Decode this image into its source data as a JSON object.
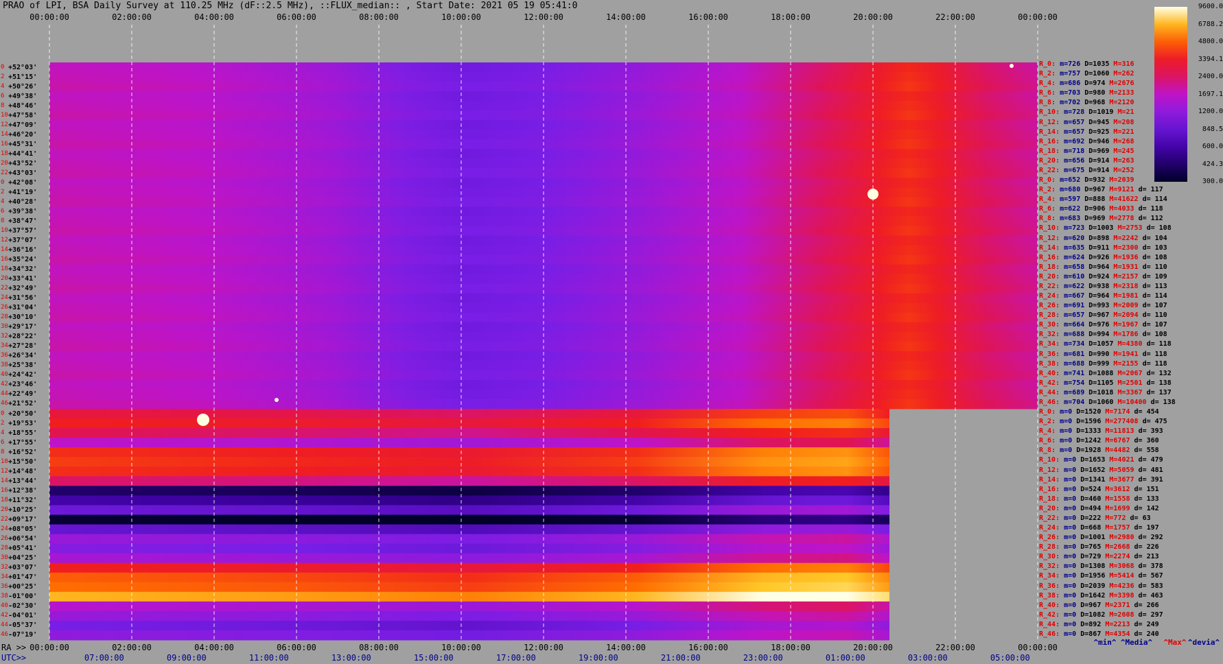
{
  "title": "PRAO of LPI, BSA Daily Survey at 110.25 MHz (dF::2.5 MHz), ::FLUX_median:: , Start Date: 2021 05 19 05:41:0",
  "colors": {
    "background": "#a0a0a0",
    "grid": "#ffffff",
    "label_red": "#e00000",
    "label_blue": "#00008b"
  },
  "top_ticks": [
    "00:00:00",
    "02:00:00",
    "04:00:00",
    "06:00:00",
    "08:00:00",
    "10:00:00",
    "12:00:00",
    "14:00:00",
    "16:00:00",
    "18:00:00",
    "20:00:00",
    "22:00:00",
    "00:00:00"
  ],
  "bottom_ra_label": "RA >>",
  "bottom_ra_ticks": [
    "00:00:00",
    "02:00:00",
    "04:00:00",
    "06:00:00",
    "08:00:00",
    "10:00:00",
    "12:00:00",
    "14:00:00",
    "16:00:00",
    "18:00:00",
    "20:00:00",
    "22:00:00",
    "00:00:00"
  ],
  "bottom_utc_label": "UTC>>",
  "bottom_utc_ticks": [
    "07:00:00",
    "09:00:00",
    "11:00:00",
    "13:00:00",
    "15:00:00",
    "17:00:00",
    "19:00:00",
    "21:00:00",
    "23:00:00",
    "01:00:00",
    "03:00:00",
    "05:00:00"
  ],
  "upper_rows": {
    "indices": [
      "0",
      "2",
      "4",
      "6",
      "8",
      "10",
      "12",
      "14",
      "16",
      "18",
      "20",
      "22",
      "0",
      "2",
      "4",
      "6",
      "8",
      "10",
      "12",
      "14",
      "16",
      "18",
      "20",
      "22",
      "24",
      "26",
      "28",
      "30",
      "32",
      "34",
      "36",
      "38",
      "40",
      "42",
      "44",
      "46"
    ],
    "declinations": [
      "+52°03'",
      "+51°15'",
      "+50°26'",
      "+49°38'",
      "+48°46'",
      "+47°58'",
      "+47°09'",
      "+46°20'",
      "+45°31'",
      "+44°41'",
      "+43°52'",
      "+43°03'",
      "+42°08'",
      "+41°19'",
      "+40°28'",
      "+39°38'",
      "+38°47'",
      "+37°57'",
      "+37°07'",
      "+36°16'",
      "+35°24'",
      "+34°32'",
      "+33°41'",
      "+32°49'",
      "+31°56'",
      "+31°04'",
      "+30°10'",
      "+29°17'",
      "+28°22'",
      "+27°28'",
      "+26°34'",
      "+25°38'",
      "+24°42'",
      "+23°46'",
      "+22°49'",
      "+21°52'"
    ]
  },
  "lower_rows": {
    "indices": [
      "0",
      "2",
      "4",
      "6",
      "8",
      "10",
      "12",
      "14",
      "16",
      "18",
      "20",
      "22",
      "24",
      "26",
      "28",
      "30",
      "32",
      "34",
      "36",
      "38",
      "40",
      "42",
      "44",
      "46"
    ],
    "declinations": [
      "+20°50'",
      "+19°53'",
      "+18°55'",
      "+17°55'",
      "+16°52'",
      "+15°50'",
      "+14°48'",
      "+13°44'",
      "+12°38'",
      "+11°32'",
      "+10°25'",
      "+09°17'",
      "+08°05'",
      "+06°54'",
      "+05°41'",
      "+04°25'",
      "+03°07'",
      "+01°47'",
      "+00°25'",
      "-01°00'",
      "-02°30'",
      "-04°01'",
      "-05°37'",
      "-07°19'"
    ]
  },
  "stats": [
    {
      "r": "R_0:",
      "m": "m=726",
      "d": "D=1035",
      "M": "M=316",
      "dd": ""
    },
    {
      "r": "R_2:",
      "m": "m=757",
      "d": "D=1060",
      "M": "M=262",
      "dd": ""
    },
    {
      "r": "R_4:",
      "m": "m=686",
      "d": "D=974",
      "M": "M=2676",
      "dd": ""
    },
    {
      "r": "R_6:",
      "m": "m=703",
      "d": "D=980",
      "M": "M=2133",
      "dd": ""
    },
    {
      "r": "R_8:",
      "m": "m=702",
      "d": "D=968",
      "M": "M=2120",
      "dd": ""
    },
    {
      "r": "R_10:",
      "m": "m=728",
      "d": "D=1019",
      "M": "M=21",
      "dd": ""
    },
    {
      "r": "R_12:",
      "m": "m=657",
      "d": "D=945",
      "M": "M=208",
      "dd": ""
    },
    {
      "r": "R_14:",
      "m": "m=657",
      "d": "D=925",
      "M": "M=221",
      "dd": ""
    },
    {
      "r": "R_16:",
      "m": "m=692",
      "d": "D=946",
      "M": "M=268",
      "dd": ""
    },
    {
      "r": "R_18:",
      "m": "m=718",
      "d": "D=969",
      "M": "M=245",
      "dd": ""
    },
    {
      "r": "R_20:",
      "m": "m=656",
      "d": "D=914",
      "M": "M=263",
      "dd": ""
    },
    {
      "r": "R_22:",
      "m": "m=675",
      "d": "D=914",
      "M": "M=252",
      "dd": ""
    },
    {
      "r": "R_0:",
      "m": "m=652",
      "d": "D=932",
      "M": "M=2039",
      "dd": ""
    },
    {
      "r": "R_2:",
      "m": "m=680",
      "d": "D=967",
      "M": "M=9121",
      "dd": "d= 117"
    },
    {
      "r": "R_4:",
      "m": "m=597",
      "d": "D=888",
      "M": "M=41622",
      "dd": "d= 114"
    },
    {
      "r": "R_6:",
      "m": "m=622",
      "d": "D=906",
      "M": "M=4033",
      "dd": "d= 118"
    },
    {
      "r": "R_8:",
      "m": "m=683",
      "d": "D=969",
      "M": "M=2778",
      "dd": "d= 112"
    },
    {
      "r": "R_10:",
      "m": "m=723",
      "d": "D=1003",
      "M": "M=2753",
      "dd": "d= 108"
    },
    {
      "r": "R_12:",
      "m": "m=620",
      "d": "D=898",
      "M": "M=2242",
      "dd": "d= 104"
    },
    {
      "r": "R_14:",
      "m": "m=635",
      "d": "D=911",
      "M": "M=2300",
      "dd": "d= 103"
    },
    {
      "r": "R_16:",
      "m": "m=624",
      "d": "D=926",
      "M": "M=1936",
      "dd": "d= 108"
    },
    {
      "r": "R_18:",
      "m": "m=658",
      "d": "D=964",
      "M": "M=1931",
      "dd": "d= 110"
    },
    {
      "r": "R_20:",
      "m": "m=610",
      "d": "D=924",
      "M": "M=2157",
      "dd": "d= 109"
    },
    {
      "r": "R_22:",
      "m": "m=622",
      "d": "D=938",
      "M": "M=2318",
      "dd": "d= 113"
    },
    {
      "r": "R_24:",
      "m": "m=667",
      "d": "D=964",
      "M": "M=1981",
      "dd": "d= 114"
    },
    {
      "r": "R_26:",
      "m": "m=691",
      "d": "D=993",
      "M": "M=2009",
      "dd": "d= 107"
    },
    {
      "r": "R_28:",
      "m": "m=657",
      "d": "D=967",
      "M": "M=2094",
      "dd": "d= 110"
    },
    {
      "r": "R_30:",
      "m": "m=664",
      "d": "D=976",
      "M": "M=1967",
      "dd": "d= 107"
    },
    {
      "r": "R_32:",
      "m": "m=688",
      "d": "D=994",
      "M": "M=1786",
      "dd": "d= 108"
    },
    {
      "r": "R_34:",
      "m": "m=734",
      "d": "D=1057",
      "M": "M=4380",
      "dd": "d= 118"
    },
    {
      "r": "R_36:",
      "m": "m=681",
      "d": "D=990",
      "M": "M=1941",
      "dd": "d= 118"
    },
    {
      "r": "R_38:",
      "m": "m=688",
      "d": "D=999",
      "M": "M=2155",
      "dd": "d= 118"
    },
    {
      "r": "R_40:",
      "m": "m=741",
      "d": "D=1088",
      "M": "M=2067",
      "dd": "d= 132"
    },
    {
      "r": "R_42:",
      "m": "m=754",
      "d": "D=1105",
      "M": "M=2501",
      "dd": "d= 138"
    },
    {
      "r": "R_44:",
      "m": "m=689",
      "d": "D=1018",
      "M": "M=3367",
      "dd": "d= 137"
    },
    {
      "r": "R_46:",
      "m": "m=704",
      "d": "D=1060",
      "M": "M=10400",
      "dd": "d= 138"
    },
    {
      "r": "R_0:",
      "m": "m=0",
      "d": "D=1520",
      "M": "M=7174",
      "dd": "d= 454"
    },
    {
      "r": "R_2:",
      "m": "m=0",
      "d": "D=1596",
      "M": "M=277408",
      "dd": "d= 475"
    },
    {
      "r": "R_4:",
      "m": "m=0",
      "d": "D=1333",
      "M": "M=11813",
      "dd": "d= 393"
    },
    {
      "r": "R_6:",
      "m": "m=0",
      "d": "D=1242",
      "M": "M=6767",
      "dd": "d= 360"
    },
    {
      "r": "R_8:",
      "m": "m=0",
      "d": "D=1928",
      "M": "M=4482",
      "dd": "d= 558"
    },
    {
      "r": "R_10:",
      "m": "m=0",
      "d": "D=1653",
      "M": "M=4021",
      "dd": "d= 479"
    },
    {
      "r": "R_12:",
      "m": "m=0",
      "d": "D=1652",
      "M": "M=5059",
      "dd": "d= 481"
    },
    {
      "r": "R_14:",
      "m": "m=0",
      "d": "D=1341",
      "M": "M=3677",
      "dd": "d= 391"
    },
    {
      "r": "R_16:",
      "m": "m=0",
      "d": "D=524",
      "M": "M=3612",
      "dd": "d= 151"
    },
    {
      "r": "R_18:",
      "m": "m=0",
      "d": "D=460",
      "M": "M=1558",
      "dd": "d= 133"
    },
    {
      "r": "R_20:",
      "m": "m=0",
      "d": "D=494",
      "M": "M=1699",
      "dd": "d= 142"
    },
    {
      "r": "R_22:",
      "m": "m=0",
      "d": "D=222",
      "M": "M=772",
      "dd": "d= 63"
    },
    {
      "r": "R_24:",
      "m": "m=0",
      "d": "D=668",
      "M": "M=1757",
      "dd": "d= 197"
    },
    {
      "r": "R_26:",
      "m": "m=0",
      "d": "D=1001",
      "M": "M=2980",
      "dd": "d= 292"
    },
    {
      "r": "R_28:",
      "m": "m=0",
      "d": "D=765",
      "M": "M=2668",
      "dd": "d= 226"
    },
    {
      "r": "R_30:",
      "m": "m=0",
      "d": "D=729",
      "M": "M=2274",
      "dd": "d= 213"
    },
    {
      "r": "R_32:",
      "m": "m=0",
      "d": "D=1308",
      "M": "M=3068",
      "dd": "d= 378"
    },
    {
      "r": "R_34:",
      "m": "m=0",
      "d": "D=1956",
      "M": "M=5414",
      "dd": "d= 567"
    },
    {
      "r": "R_36:",
      "m": "m=0",
      "d": "D=2039",
      "M": "M=4236",
      "dd": "d= 583"
    },
    {
      "r": "R_38:",
      "m": "m=0",
      "d": "D=1642",
      "M": "M=3398",
      "dd": "d= 463"
    },
    {
      "r": "R_40:",
      "m": "m=0",
      "d": "D=967",
      "M": "M=2371",
      "dd": "d= 266"
    },
    {
      "r": "R_42:",
      "m": "m=0",
      "d": "D=1082",
      "M": "M=2608",
      "dd": "d= 297"
    },
    {
      "r": "R_44:",
      "m": "m=0",
      "d": "D=892",
      "M": "M=2213",
      "dd": "d= 249"
    },
    {
      "r": "R_46:",
      "m": "m=0",
      "d": "D=867",
      "M": "M=4354",
      "dd": "d= 240"
    }
  ],
  "legend": {
    "min": "^min^",
    "media": "^Media^",
    "max": "^Max^",
    "devia": "^devia^"
  },
  "chart_data": {
    "type": "heatmap",
    "title": "PRAO of LPI, BSA Daily Survey at 110.25 MHz (dF::2.5 MHz), ::FLUX_median:: , Start Date: 2021 05 19 05:41:0",
    "colorbar_ticks": [
      "9600.0",
      "6788.2",
      "4800.0",
      "3394.1",
      "2400.0",
      "1697.1",
      "1200.0",
      "848.5",
      "600.0",
      "424.3",
      "300.0"
    ],
    "colorbar_range": [
      300,
      9600
    ],
    "colorbar_scale": "log",
    "x_axis_ra_hours": [
      0,
      24
    ],
    "lower_block_end_ra_hours": 20.4
  }
}
